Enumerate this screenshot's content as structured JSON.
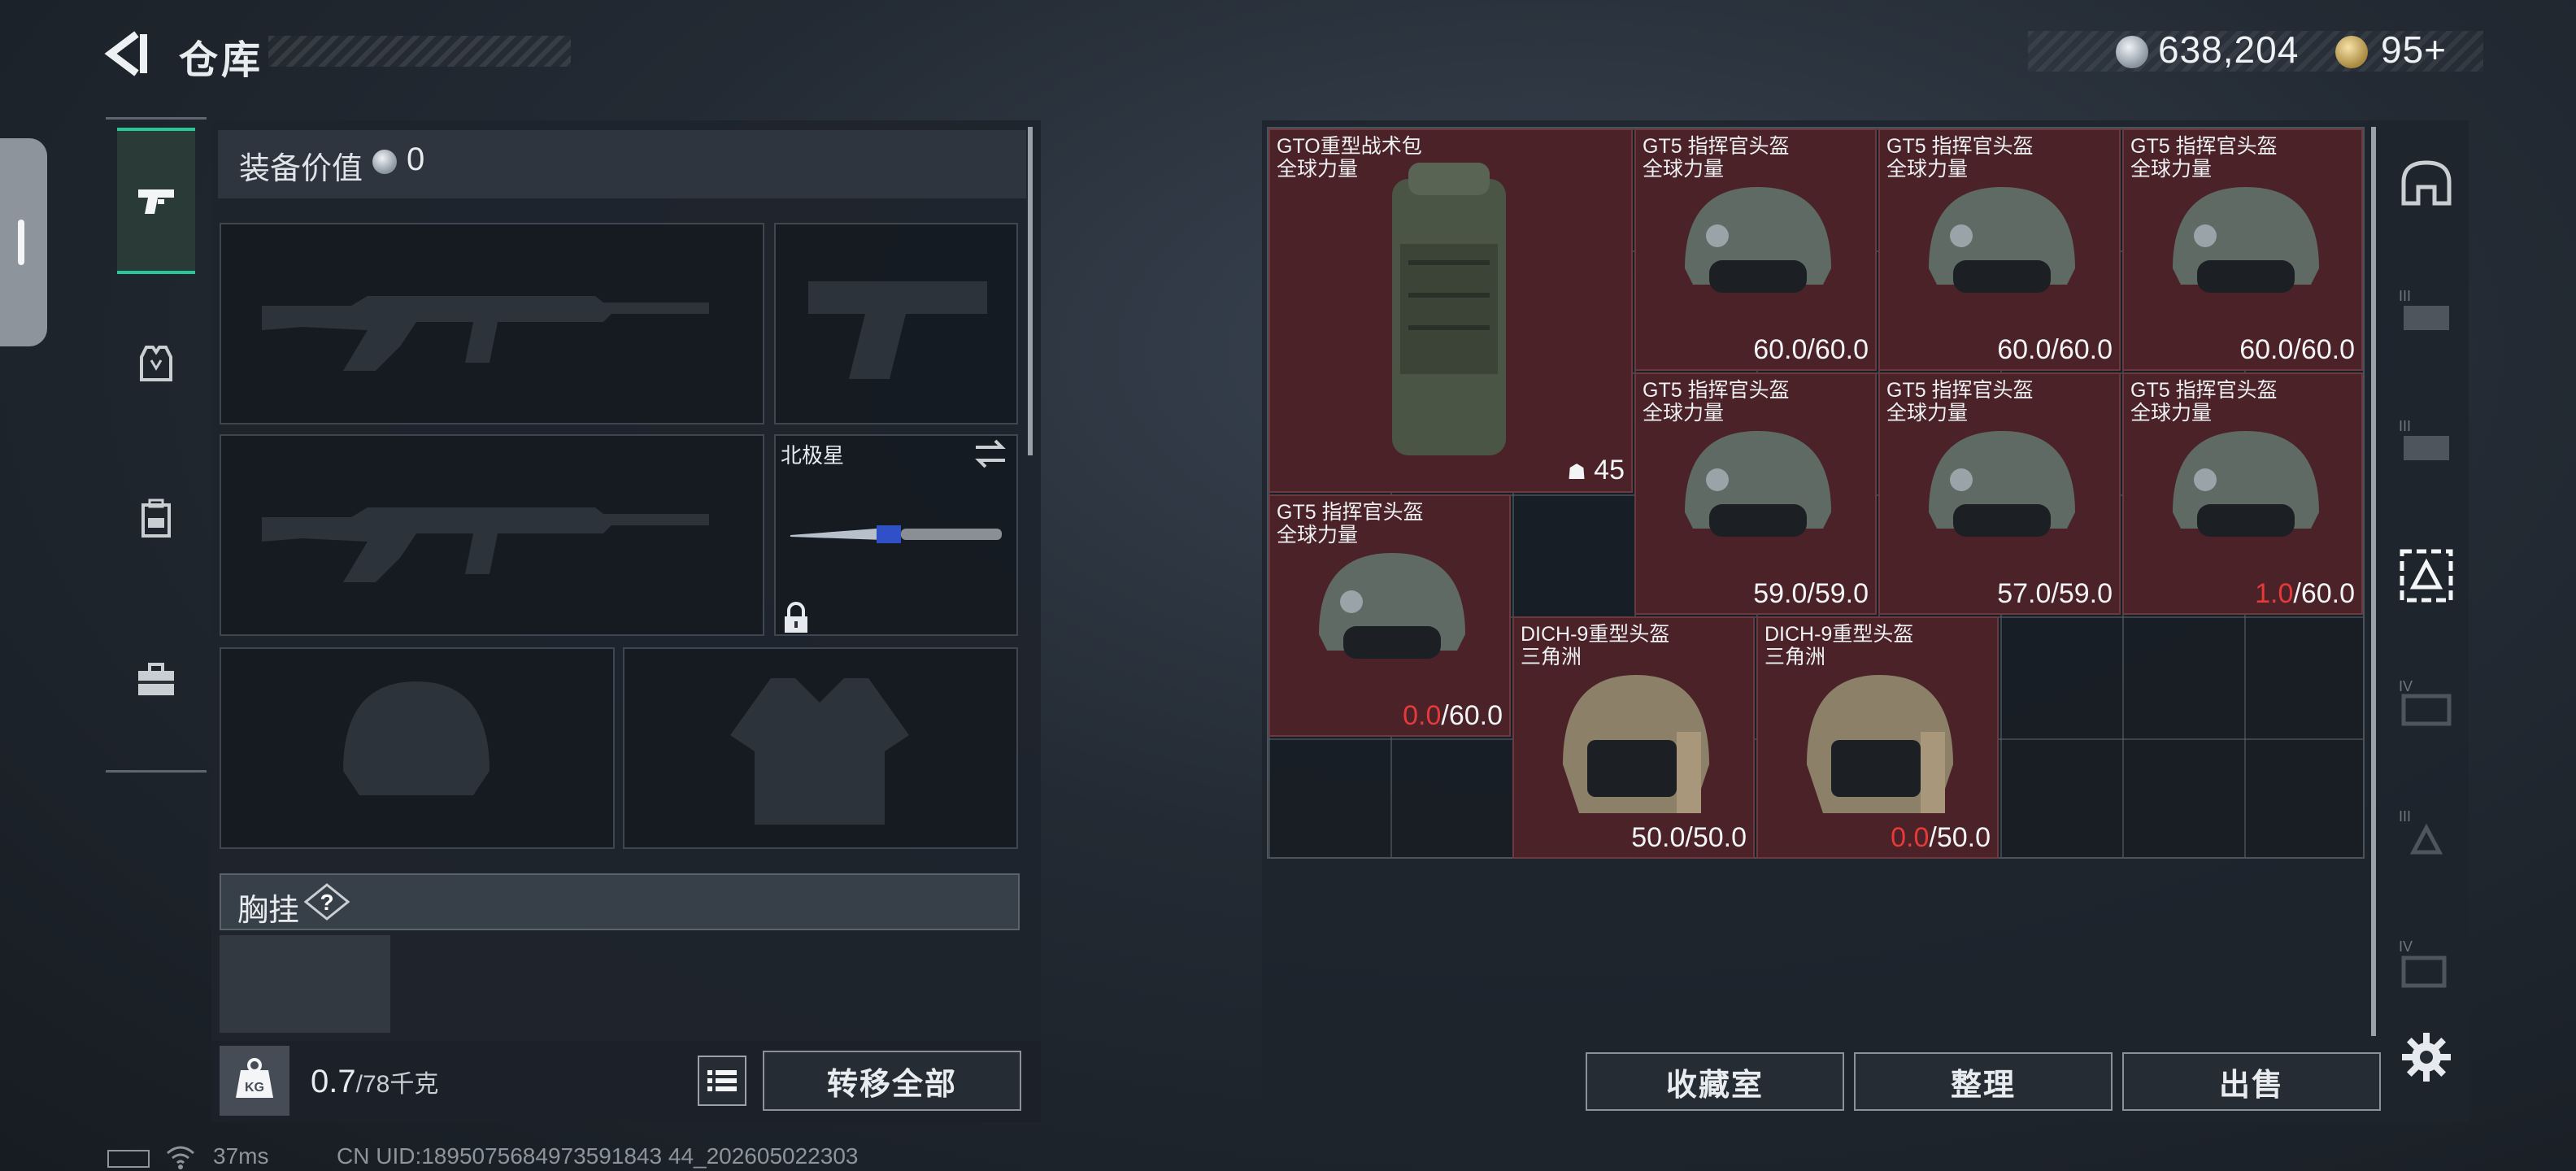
{
  "header": {
    "title": "仓库",
    "silver_currency": "638,204",
    "gold_currency": "95+"
  },
  "equipment": {
    "value_label": "装备价值",
    "value": "0",
    "knife_name": "北极星",
    "chest_rig_label": "胸挂",
    "help_glyph": "?",
    "weight_current": "0.7",
    "weight_capacity": "/78千克",
    "transfer_all_label": "转移全部"
  },
  "warehouse": {
    "items": [
      {
        "name": "GTO重型战术包",
        "sub": "全球力量",
        "capacity": "45",
        "type": "backpack"
      },
      {
        "name": "GT5 指挥官头盔",
        "sub": "全球力量",
        "cur": "60.0",
        "max": "/60.0",
        "low": false
      },
      {
        "name": "GT5 指挥官头盔",
        "sub": "全球力量",
        "cur": "60.0",
        "max": "/60.0",
        "low": false
      },
      {
        "name": "GT5 指挥官头盔",
        "sub": "全球力量",
        "cur": "60.0",
        "max": "/60.0",
        "low": false
      },
      {
        "name": "GT5 指挥官头盔",
        "sub": "全球力量",
        "cur": "59.0",
        "max": "/59.0",
        "low": false
      },
      {
        "name": "GT5 指挥官头盔",
        "sub": "全球力量",
        "cur": "57.0",
        "max": "/59.0",
        "low": false
      },
      {
        "name": "GT5 指挥官头盔",
        "sub": "全球力量",
        "cur": "1.0",
        "max": "/60.0",
        "low": true
      },
      {
        "name": "GT5 指挥官头盔",
        "sub": "全球力量",
        "cur": "0.0",
        "max": "/60.0",
        "low": true
      },
      {
        "name": "DICH-9重型头盔",
        "sub": "三角洲",
        "cur": "50.0",
        "max": "/50.0",
        "low": false
      },
      {
        "name": "DICH-9重型头盔",
        "sub": "三角洲",
        "cur": "0.0",
        "max": "/50.0",
        "low": true
      }
    ],
    "buttons": {
      "collection": "收藏室",
      "sort": "整理",
      "sell": "出售"
    },
    "side_tab_numerals": [
      "III",
      "III",
      "IV",
      "III",
      "IV"
    ]
  },
  "status": {
    "ping": "37ms",
    "uid": "CN UID:1895075684973591843 44_202605022303"
  },
  "colors": {
    "item_bg": "#4a2228",
    "accent_green": "#27c79a",
    "low_durability": "#e63a3a"
  }
}
